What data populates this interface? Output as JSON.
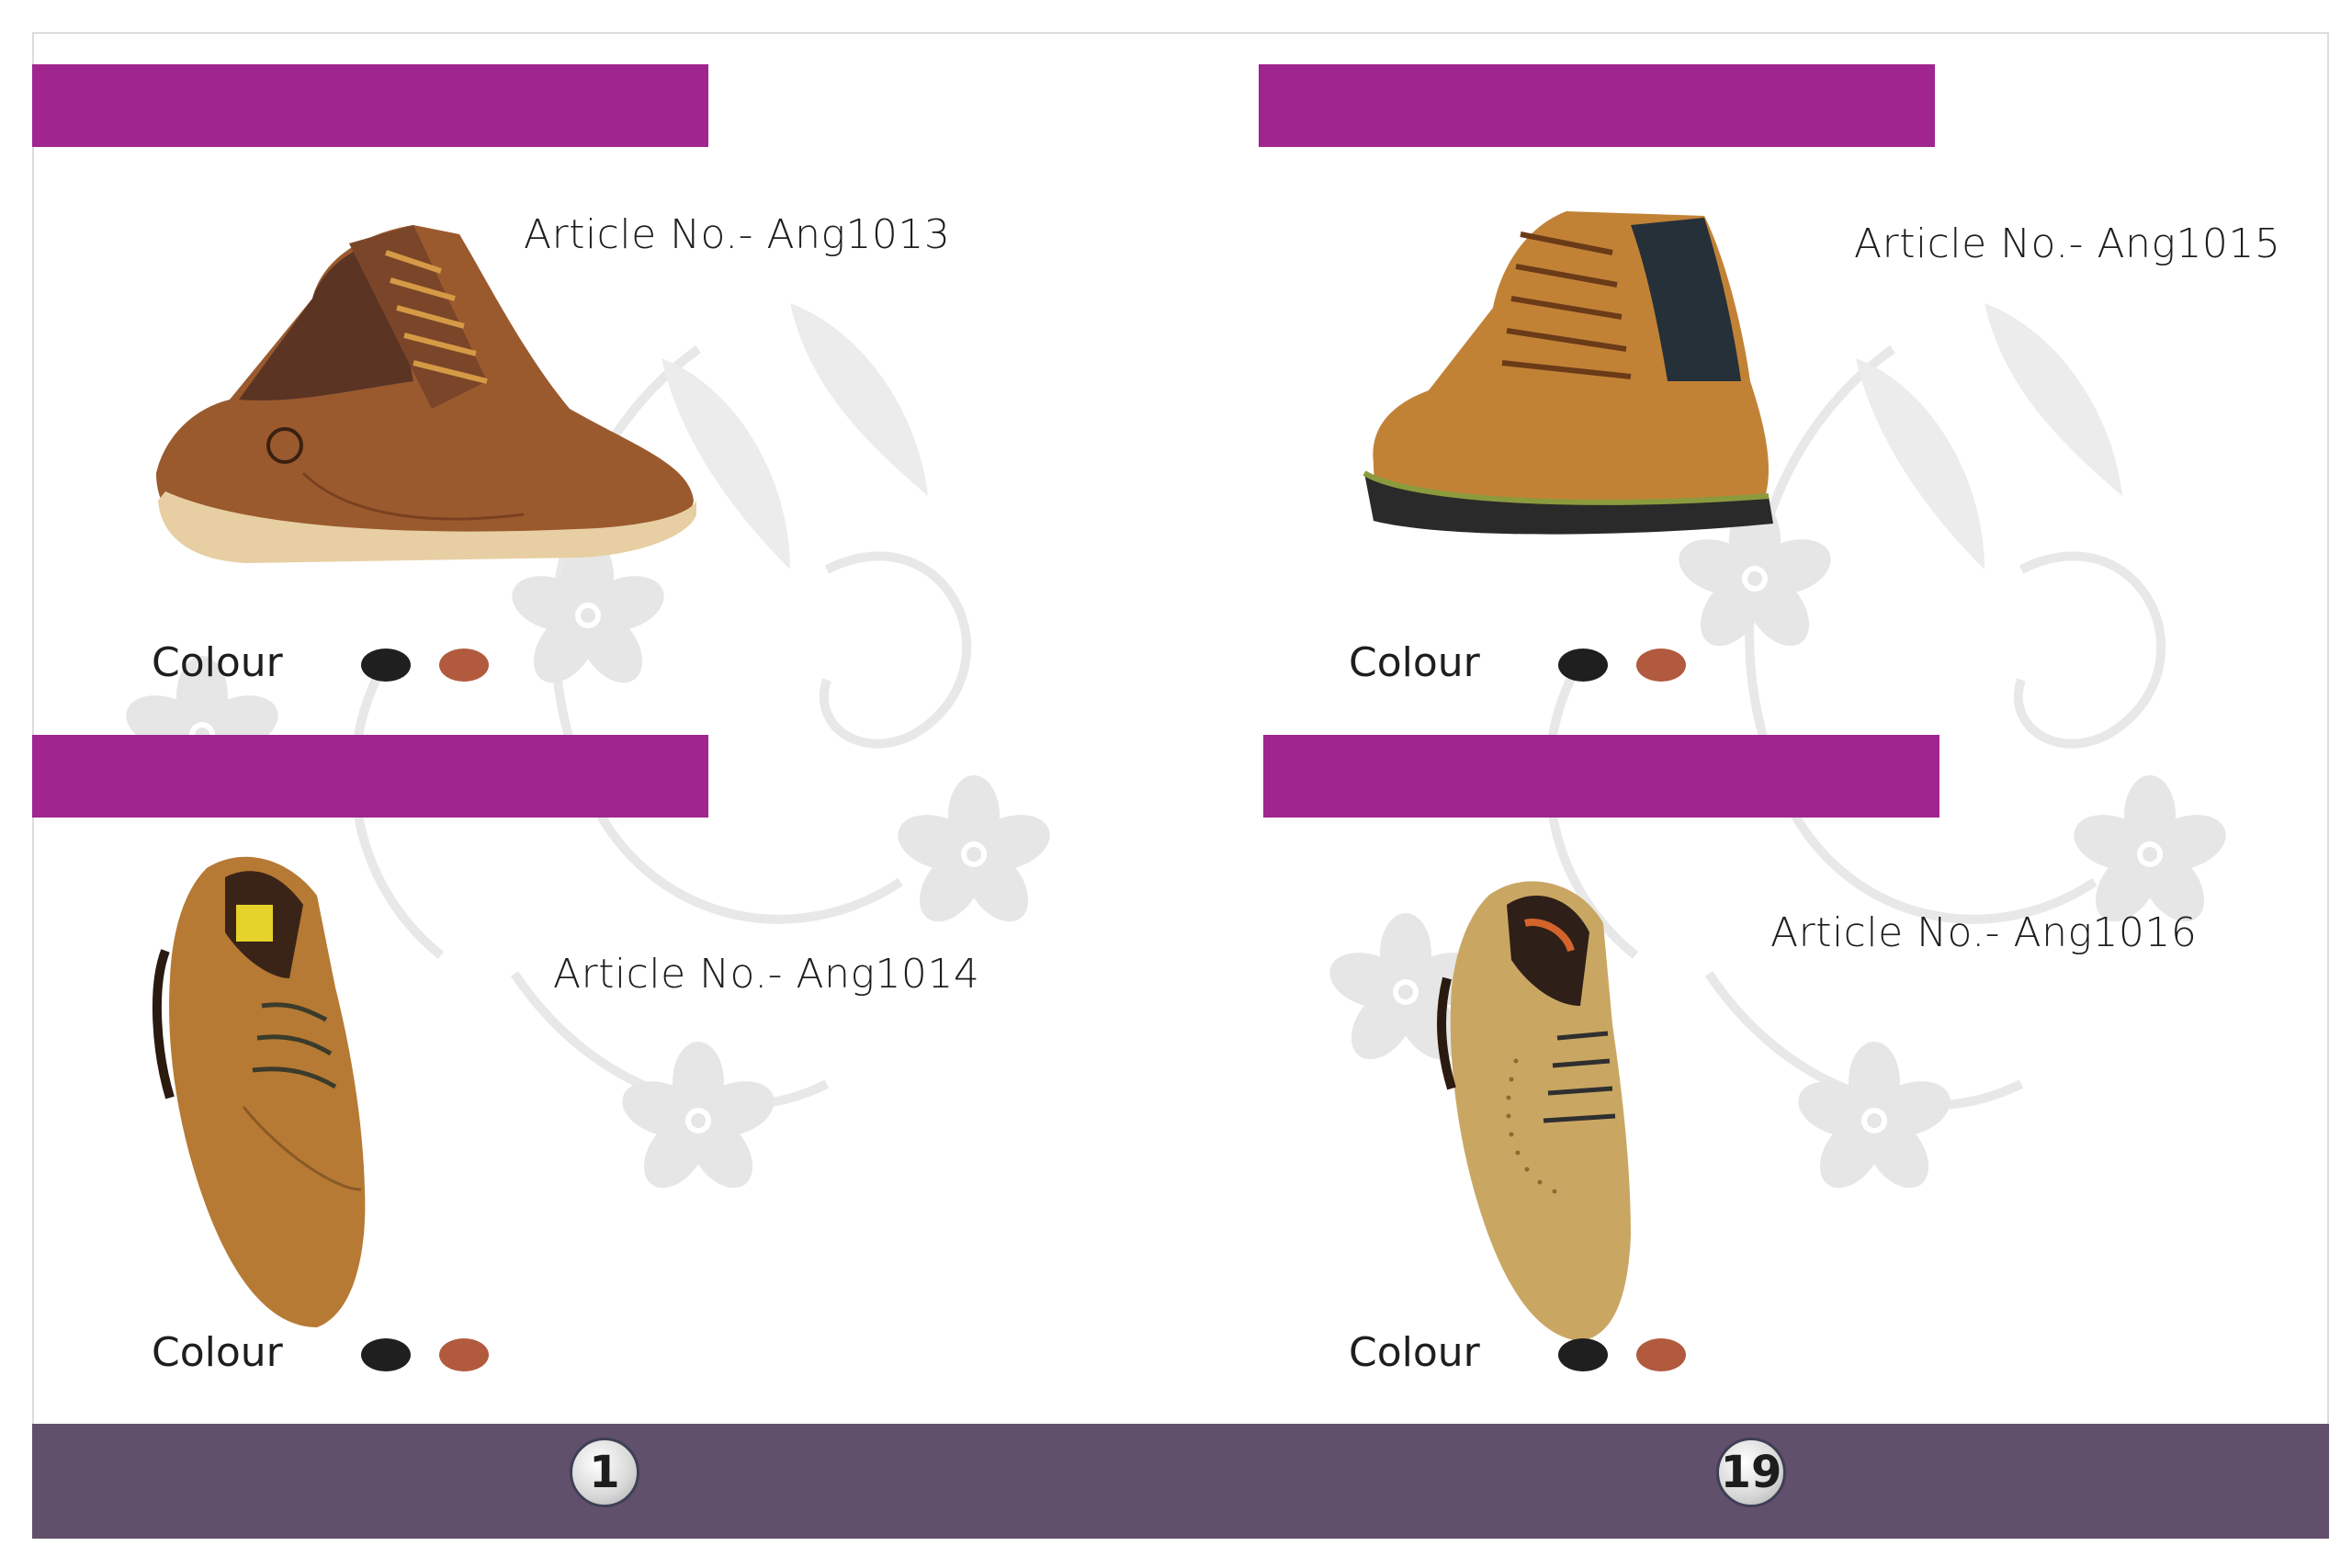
{
  "colors": {
    "magenta_bar": "#a0258f",
    "footer": "#61506b",
    "swatch_black": "#1f1f1f",
    "swatch_brown": "#b25a3e"
  },
  "products": [
    {
      "article": "Article No.- Ang1013",
      "colour_label": "Colour",
      "swatches": [
        "black",
        "brown"
      ],
      "shoe_type": "brown leather high-top lace-up boot"
    },
    {
      "article": "Article No.- Ang1014",
      "colour_label": "Colour",
      "swatches": [
        "black",
        "brown"
      ],
      "shoe_type": "tan leather derby shoe"
    },
    {
      "article": "Article No.- Ang1015",
      "colour_label": "Colour",
      "swatches": [
        "black",
        "brown"
      ],
      "shoe_type": "tan rugged ankle boot"
    },
    {
      "article": "Article No.- Ang1016",
      "colour_label": "Colour",
      "swatches": [
        "black",
        "brown"
      ],
      "shoe_type": "beige brogue oxford shoe"
    }
  ],
  "footer": {
    "left_page": "1",
    "right_page": "19"
  }
}
